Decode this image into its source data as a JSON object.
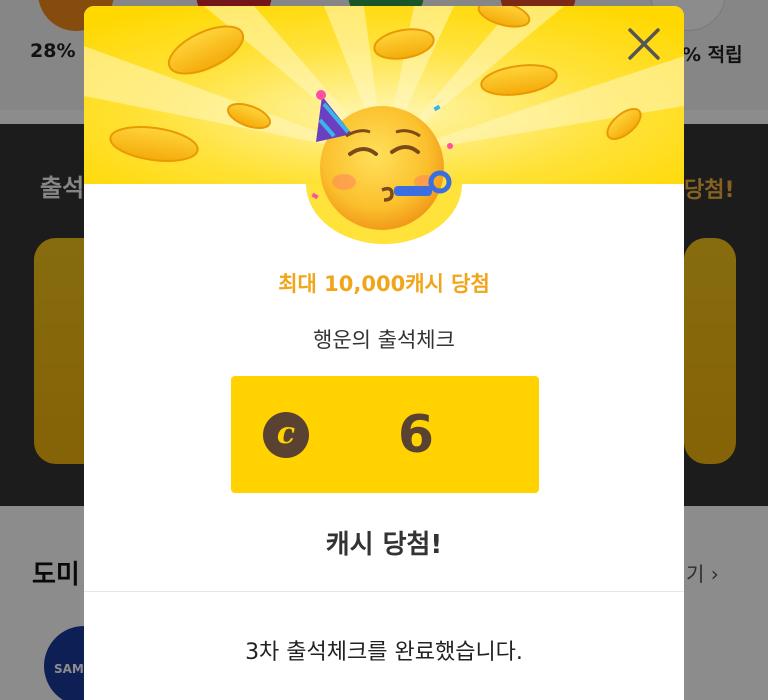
{
  "background": {
    "top_left_percent": "28%",
    "top_right_reward": "% 적립",
    "band_title_left": "출석",
    "band_title_right": "당첨!",
    "section_title_left": "도미",
    "section_more": "기 ›",
    "logo_text": "SAM"
  },
  "modal": {
    "close_icon": "close-icon",
    "prize_title": "최대 10,000캐시 당첨",
    "event_name": "행운의 출석체크",
    "cash": {
      "coin_symbol": "c",
      "amount": "6"
    },
    "win_text": "캐시 당첨!",
    "complete_message": "3차 출석체크를 완료했습니다."
  },
  "colors": {
    "accent_yellow": "#ffd200",
    "prize_orange": "#f0a51a",
    "coin_brown": "#5a4232"
  }
}
